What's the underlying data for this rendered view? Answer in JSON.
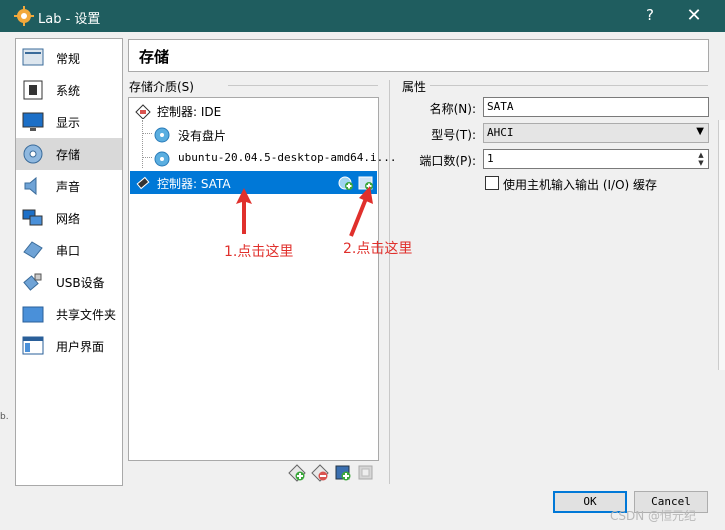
{
  "window": {
    "title": "Lab - 设置",
    "help_label": "?",
    "close_label": "✕"
  },
  "sidebar": {
    "items": [
      {
        "label": "常规",
        "icon": "general-icon"
      },
      {
        "label": "系统",
        "icon": "system-chip-icon"
      },
      {
        "label": "显示",
        "icon": "display-monitor-icon"
      },
      {
        "label": "存储",
        "icon": "storage-disk-icon",
        "selected": true
      },
      {
        "label": "声音",
        "icon": "speaker-icon"
      },
      {
        "label": "网络",
        "icon": "network-icon"
      },
      {
        "label": "串口",
        "icon": "serial-port-icon"
      },
      {
        "label": "USB设备",
        "icon": "usb-icon"
      },
      {
        "label": "共享文件夹",
        "icon": "shared-folder-icon"
      },
      {
        "label": "用户界面",
        "icon": "user-interface-icon"
      }
    ]
  },
  "page": {
    "heading": "存储"
  },
  "storage": {
    "section_label": "存储介质(S)",
    "tree": {
      "controller_ide": "控制器: IDE",
      "empty_disc": "没有盘片",
      "iso_item": "ubuntu-20.04.5-desktop-amd64.i...",
      "controller_sata": "控制器: SATA"
    }
  },
  "attributes": {
    "section_label": "属性",
    "name_label": "名称(N):",
    "name_value": "SATA",
    "type_label": "型号(T):",
    "type_value": "AHCI",
    "port_label": "端口数(P):",
    "port_value": "1",
    "host_io_cache_label": "使用主机输入输出 (I/O) 缓存",
    "host_io_cache_checked": false
  },
  "annotations": {
    "first": "1.点击这里",
    "second": "2.点击这里",
    "color": "#e0302c"
  },
  "footer": {
    "ok_label": "OK",
    "cancel_label": "Cancel"
  },
  "misc": {
    "watermark": "CSDN @恒元纪",
    "left_edge_fragment": "b."
  },
  "colors": {
    "titlebar": "#1f5d5f",
    "selection": "#0078d7"
  }
}
